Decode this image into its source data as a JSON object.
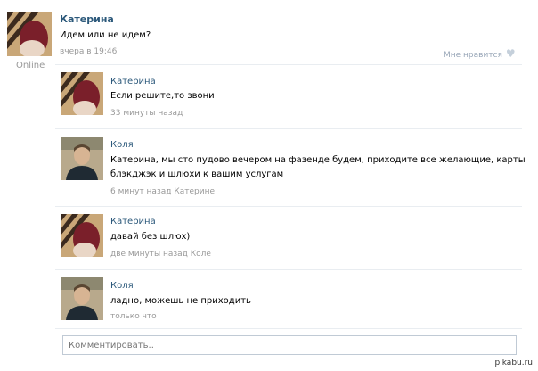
{
  "post": {
    "author": "Катерина",
    "text": "Идем или не идем?",
    "time": "вчера в 19:46",
    "like_label": "Мне нравится",
    "status": "Online"
  },
  "comments": [
    {
      "author": "Катерина",
      "text": "Если решите,то звони",
      "meta": "33 минуты назад"
    },
    {
      "author": "Коля",
      "text": "Катерина, мы сто пудово вечером на фазенде будем, приходите все желающие, карты",
      "text2": "блэкджэк и шлюхи к вашим услугам",
      "meta": "6 минут назад Катерине"
    },
    {
      "author": "Катерина",
      "text": "давай без шлюх)",
      "meta": "две минуты назад Коле"
    },
    {
      "author": "Коля",
      "text": "ладно, можешь не приходить",
      "meta": "только что"
    }
  ],
  "reply_box": {
    "placeholder": "Комментировать.."
  },
  "watermark": "pikabu.ru",
  "icons": {
    "like": "heart-icon"
  },
  "colors": {
    "name": "#2b587a",
    "meta": "#999999",
    "border": "#c0cad5"
  }
}
